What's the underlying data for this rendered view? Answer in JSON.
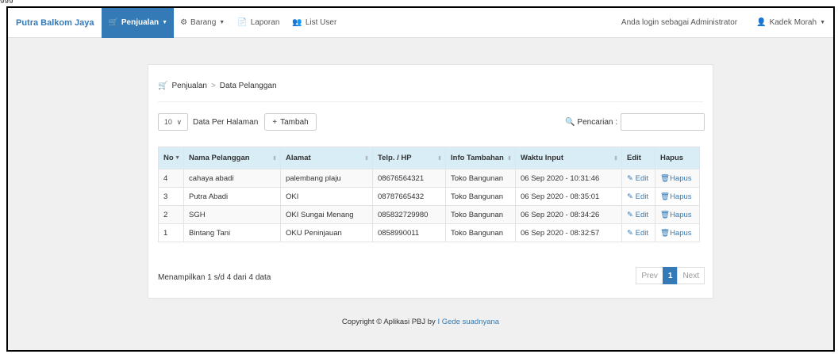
{
  "clipped_top_text": "ggg",
  "navbar": {
    "brand": "Putra Balkom Jaya",
    "items": [
      {
        "label": "Penjualan",
        "icon": "cart-icon",
        "active": true,
        "dropdown": true
      },
      {
        "label": "Barang",
        "icon": "gear-icon",
        "active": false,
        "dropdown": true
      },
      {
        "label": "Laporan",
        "icon": "document-icon",
        "active": false,
        "dropdown": false
      },
      {
        "label": "List User",
        "icon": "users-icon",
        "active": false,
        "dropdown": false
      }
    ],
    "login_text": "Anda login sebagai Administrator",
    "user_name": "Kadek Morah"
  },
  "breadcrumb": {
    "section": "Penjualan",
    "separator": ">",
    "page": "Data Pelanggan"
  },
  "controls": {
    "perpage_value": "10",
    "perpage_label": "Data Per Halaman",
    "add_label": "Tambah",
    "search_label": "Pencarian :",
    "search_value": ""
  },
  "table": {
    "headers": [
      "No",
      "Nama Pelanggan",
      "Alamat",
      "Telp. / HP",
      "Info Tambahan",
      "Waktu Input",
      "Edit",
      "Hapus"
    ],
    "rows": [
      {
        "no": "4",
        "nama": "cahaya abadi",
        "alamat": "palembang plaju",
        "telp": "08676564321",
        "info": "Toko Bangunan",
        "waktu": "06 Sep 2020 - 10:31:46",
        "edit": "Edit",
        "hapus": "Hapus"
      },
      {
        "no": "3",
        "nama": "Putra Abadi",
        "alamat": "OKI",
        "telp": "08787665432",
        "info": "Toko Bangunan",
        "waktu": "06 Sep 2020 - 08:35:01",
        "edit": "Edit",
        "hapus": "Hapus"
      },
      {
        "no": "2",
        "nama": "SGH",
        "alamat": "OKI Sungai Menang",
        "telp": "085832729980",
        "info": "Toko Bangunan",
        "waktu": "06 Sep 2020 - 08:34:26",
        "edit": "Edit",
        "hapus": "Hapus"
      },
      {
        "no": "1",
        "nama": "Bintang Tani",
        "alamat": "OKU Peninjauan",
        "telp": "0858990011",
        "info": "Toko Bangunan",
        "waktu": "06 Sep 2020 - 08:32:57",
        "edit": "Edit",
        "hapus": "Hapus"
      }
    ]
  },
  "info_text": "Menampilkan 1 s/d 4 dari 4 data",
  "pagination": {
    "prev": "Prev",
    "current": "1",
    "next": "Next"
  },
  "footer": {
    "text": "Copyright © Aplikasi PBJ by",
    "author": "I Gede suadnyana"
  },
  "colors": {
    "primary": "#337ab7",
    "header_bg": "#d9edf7",
    "page_bg": "#f0f0f0"
  }
}
